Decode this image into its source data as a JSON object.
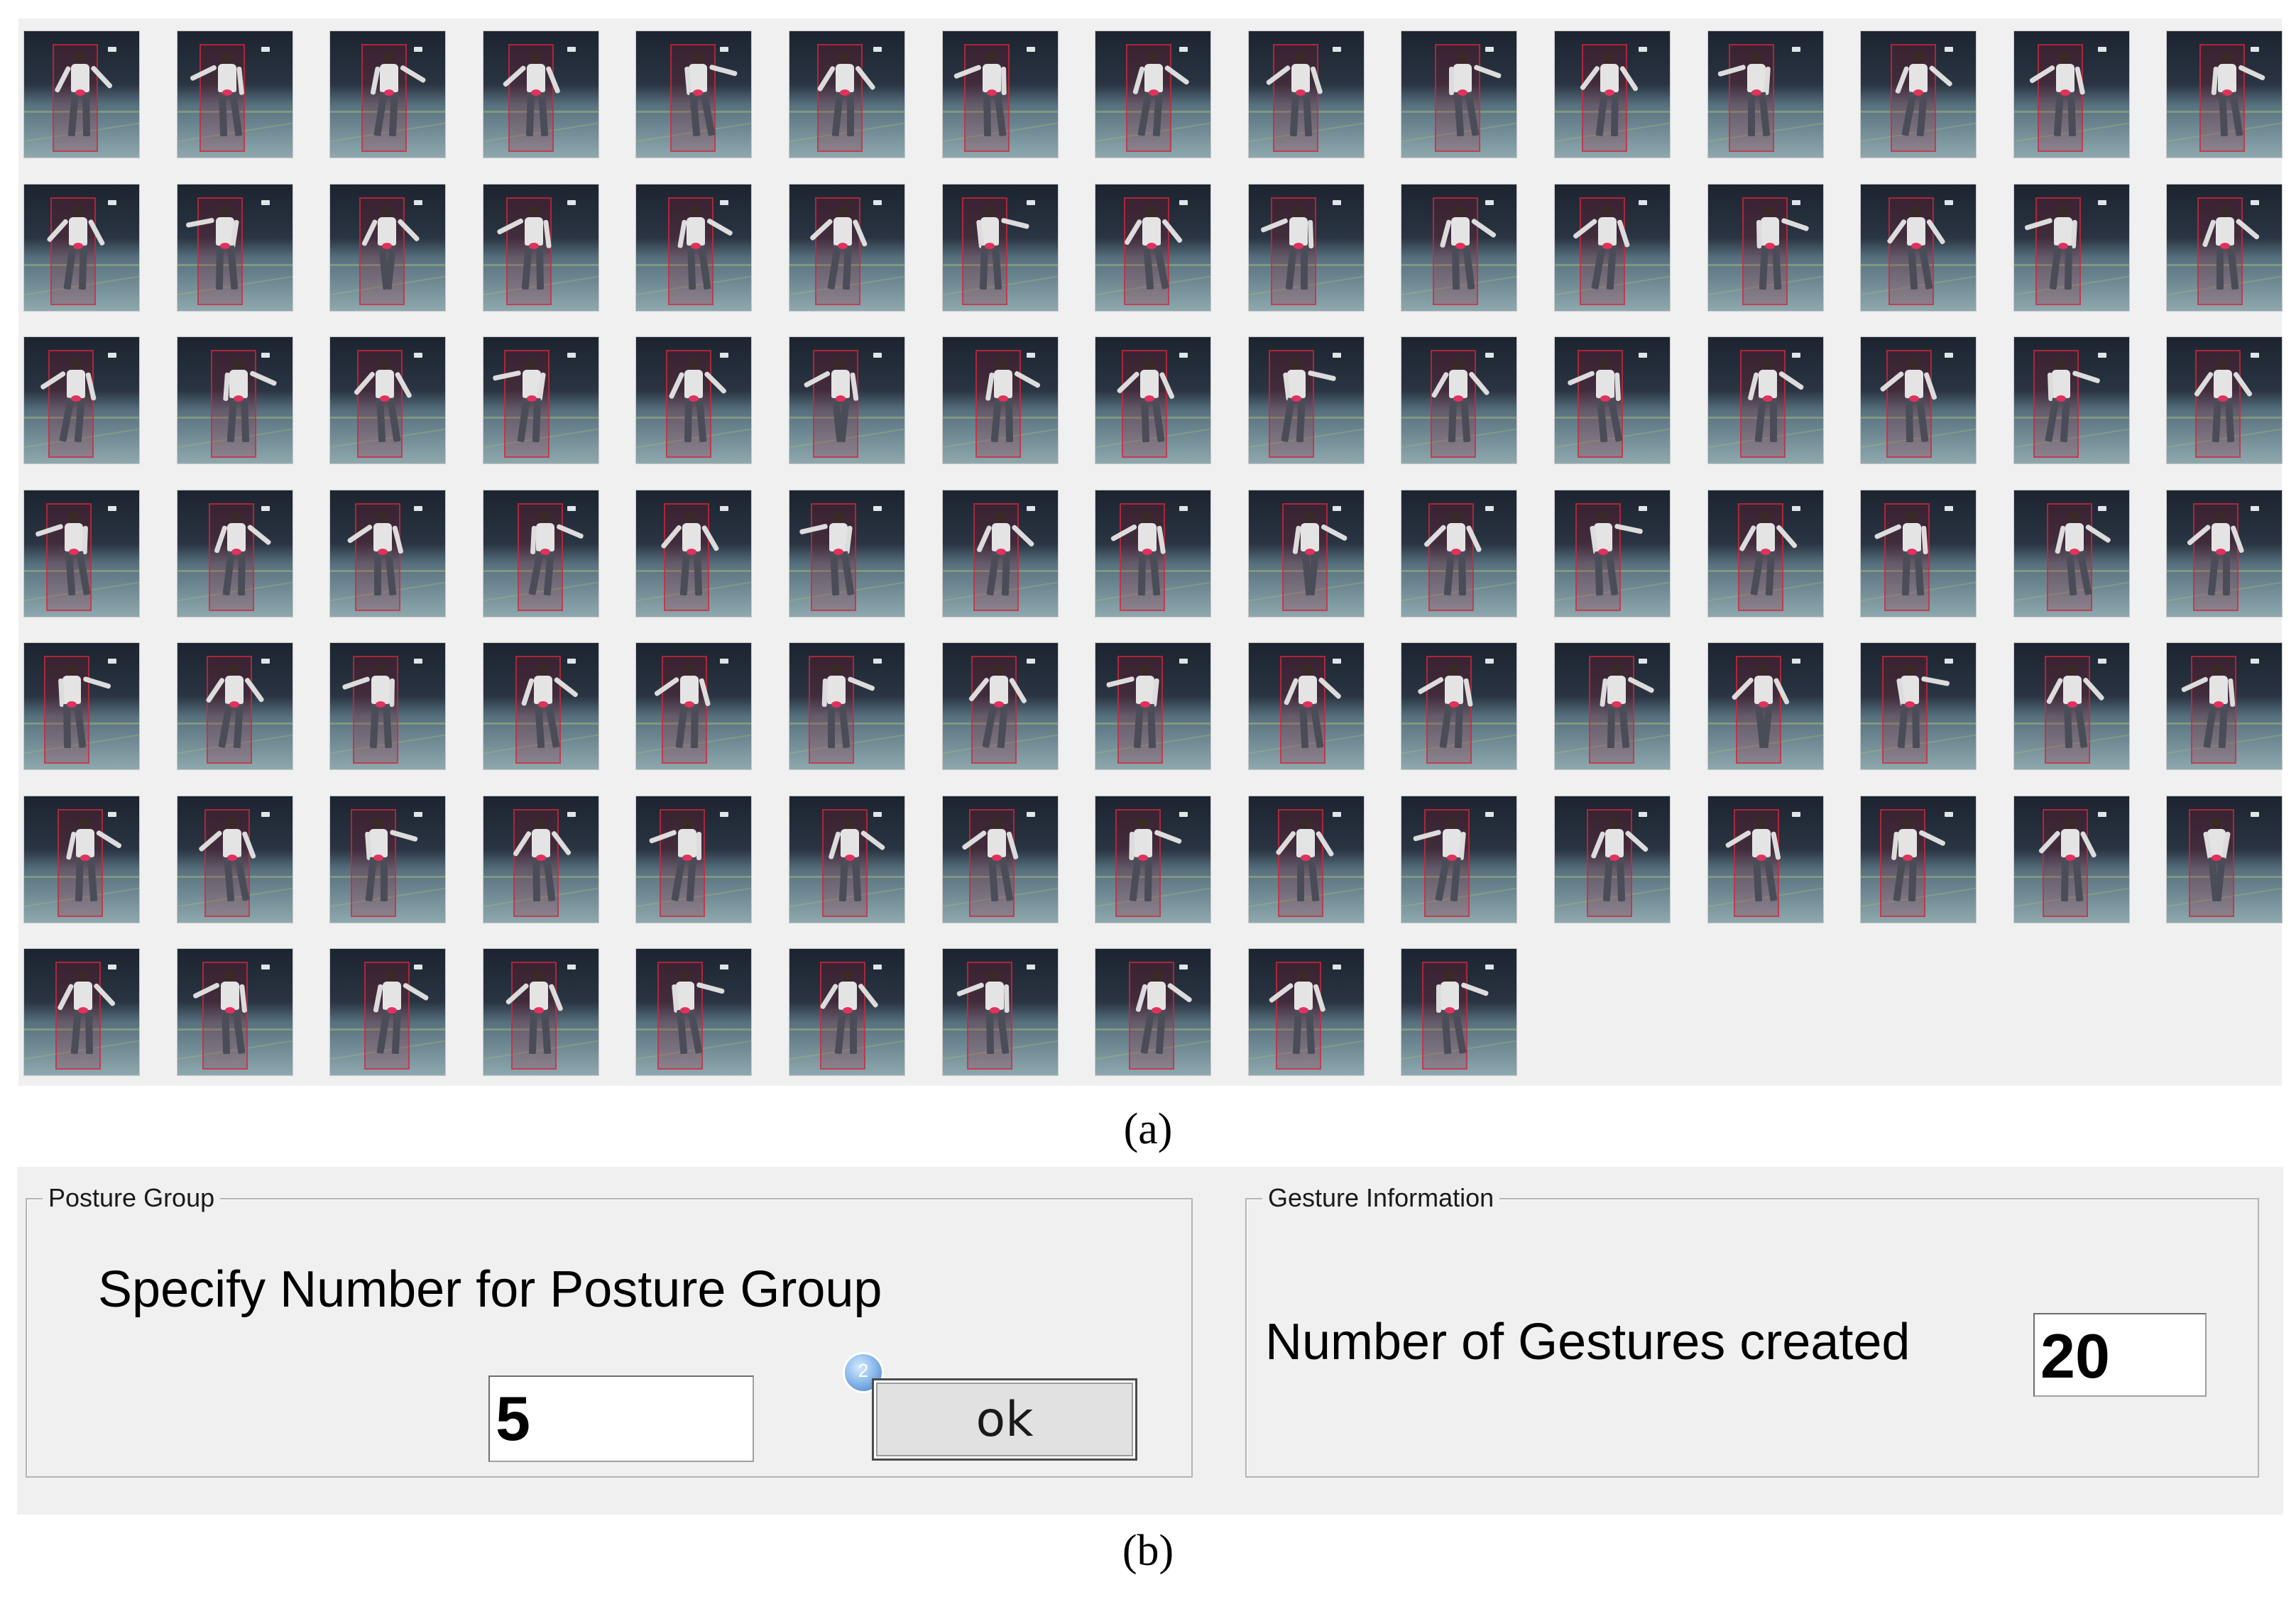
{
  "panel_a": {
    "caption": "(a)",
    "thumbnails_per_row": [
      15,
      15,
      15,
      15,
      15,
      15,
      10
    ]
  },
  "panel_b": {
    "caption": "(b)",
    "posture_group": {
      "title": "Posture Group",
      "label": "Specify Number for Posture Group",
      "input_value": "5",
      "ok_label": "ok",
      "step_badge": "2"
    },
    "gesture_information": {
      "title": "Gesture Information",
      "label": "Number of Gestures created",
      "value": "20"
    }
  }
}
